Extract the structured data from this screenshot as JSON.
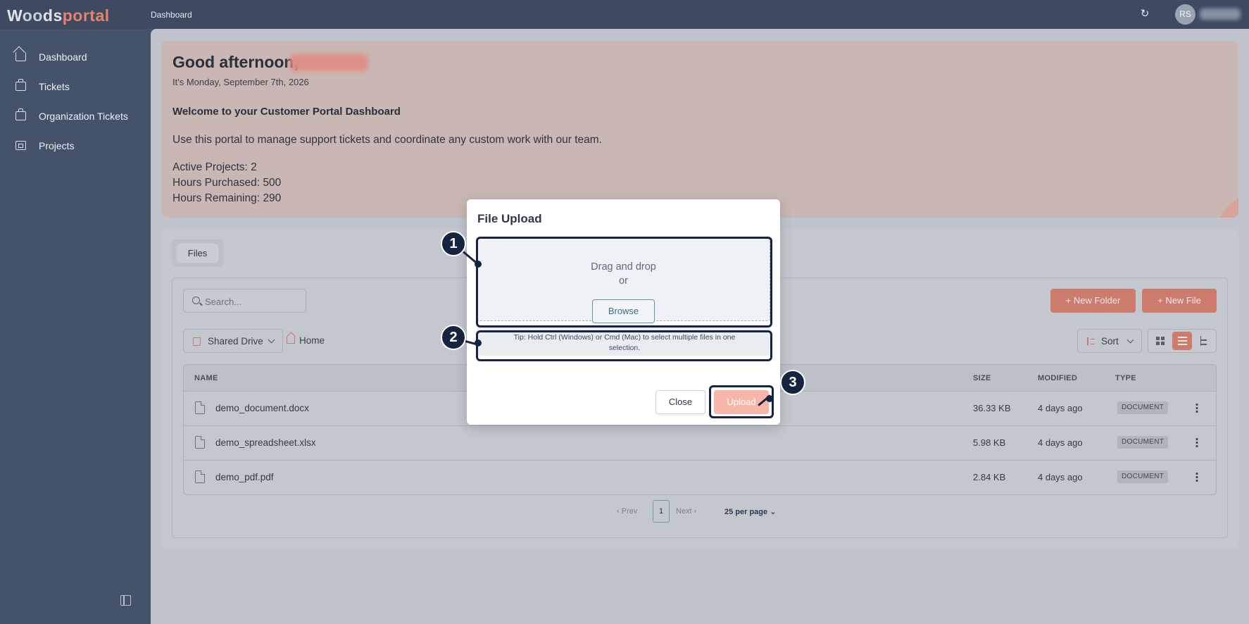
{
  "app": {
    "logo_a": "W",
    "logo_oo": "oo",
    "logo_b": "ds",
    "logo_c": "portal",
    "breadcrumb": "Dashboard",
    "user_initials": "RS"
  },
  "sidebar": {
    "items": [
      {
        "label": "Dashboard",
        "icon": "home-icon"
      },
      {
        "label": "Tickets",
        "icon": "ticket-icon"
      },
      {
        "label": "Organization Tickets",
        "icon": "ticket-icon"
      },
      {
        "label": "Projects",
        "icon": "projects-icon"
      }
    ]
  },
  "welcome": {
    "greeting": "Good afternoon,",
    "date": "It's Monday, September 7th, 2026",
    "title": "Welcome to your Customer Portal Dashboard",
    "intro": "Use this portal to manage support tickets and coordinate any custom work with our team.",
    "stats": [
      "Active Projects: 2",
      "Hours Purchased: 500",
      "Hours Remaining: 290"
    ]
  },
  "files": {
    "tab": "Files",
    "search_placeholder": "Search...",
    "new_folder": "New Folder",
    "new_file": "New File",
    "drive": "Shared Drive",
    "home": "Home",
    "sort": "Sort",
    "columns": {
      "name": "NAME",
      "size": "SIZE",
      "modified": "MODIFIED",
      "type": "TYPE"
    },
    "rows": [
      {
        "name": "demo_document.docx",
        "size": "36.33 KB",
        "modified": "4 days ago",
        "type": "DOCUMENT"
      },
      {
        "name": "demo_spreadsheet.xlsx",
        "size": "5.98 KB",
        "modified": "4 days ago",
        "type": "DOCUMENT"
      },
      {
        "name": "demo_pdf.pdf",
        "size": "2.84 KB",
        "modified": "4 days ago",
        "type": "DOCUMENT"
      }
    ],
    "pager": {
      "prev": "Prev",
      "page": "1",
      "next": "Next",
      "per_page": "25 per page"
    }
  },
  "modal": {
    "title": "File Upload",
    "drag": "Drag and drop",
    "or": "or",
    "browse": "Browse",
    "tip": "Tip: Hold Ctrl (Windows) or Cmd (Mac) to select multiple files in one selection.",
    "close": "Close",
    "upload": "Upload"
  },
  "callouts": [
    "1",
    "2",
    "3"
  ],
  "colors": {
    "accent": "#cc7b6d",
    "sidebar": "#45536a",
    "callout": "#16243f"
  }
}
